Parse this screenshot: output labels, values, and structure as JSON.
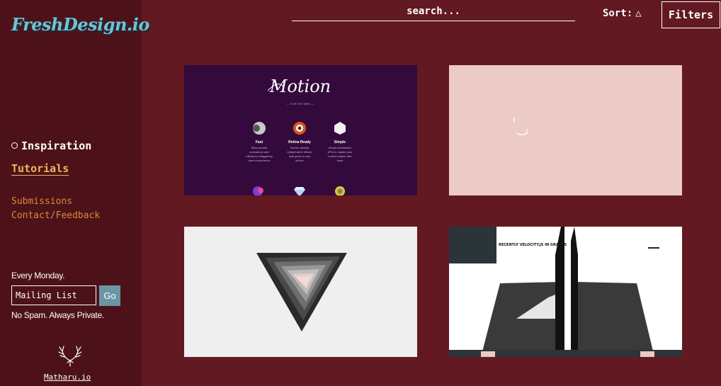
{
  "sidebar": {
    "logo": "FreshDesign.io",
    "nav_primary": "Inspiration",
    "nav_tutorials": "Tutorials",
    "nav_submissions": "Submissions",
    "nav_contact": "Contact/Feedback",
    "mail_caption": "Every Monday.",
    "mail_placeholder": "Mailing List",
    "mail_button": "Go",
    "mail_note": "No Spam. Always Private.",
    "author_link": "Matharu.io"
  },
  "header": {
    "search_placeholder": "search...",
    "sort_label": "Sort:",
    "sort_icon": "triangle-up-icon",
    "filters_label": "Filters"
  },
  "cards": [
    {
      "name": "motion",
      "logo_text": "Motion",
      "tagline": "— FOR THE WEB —",
      "features": [
        {
          "title": "Fast",
          "desc_lines": [
            "Silky smooth",
            "animations and",
            "effects for staggering",
            "user's experience"
          ]
        },
        {
          "title": "Retina Ready",
          "desc_lines": [
            "Screen density",
            "independent effects",
            "look good on any",
            "device"
          ]
        },
        {
          "title": "Simple",
          "desc_lines": [
            "Simple declarative",
            "APIs to master your",
            "motion project with",
            "ease"
          ]
        }
      ]
    },
    {
      "name": "pink-loader"
    },
    {
      "name": "triangle-spiral"
    },
    {
      "name": "velocity",
      "heading": "RECENTLY VELOCITY.JS IN GRAPHS"
    }
  ]
}
